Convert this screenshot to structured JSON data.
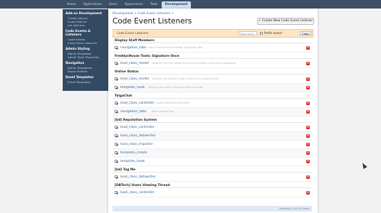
{
  "topnav": {
    "tabs": [
      {
        "label": "Home"
      },
      {
        "label": "Applications"
      },
      {
        "label": "Users"
      },
      {
        "label": "Appearance"
      },
      {
        "label": "Tools"
      },
      {
        "label": "Development"
      }
    ],
    "active_tab": "Development"
  },
  "sidebar": {
    "groups": [
      {
        "heading": "Add-on Development",
        "items": [
          "Create Add-on",
          "Install Add-on",
          "List Add-ons"
        ]
      },
      {
        "heading": "Code Events & Listeners",
        "items": [
          "Code Events",
          "Code Event Listeners"
        ]
      },
      {
        "heading": "Admin Styling",
        "items": [
          "Admin Templates",
          "Admin Style Properties"
        ]
      },
      {
        "heading": "Navigation",
        "items": [
          "Admin Navigation",
          "Route Prefixes"
        ]
      },
      {
        "heading": "Email Templates",
        "items": [
          "Email Templates"
        ]
      }
    ]
  },
  "breadcrumb": {
    "items": [
      "Development >",
      "Code Event Listeners >"
    ]
  },
  "page": {
    "title": "Code Event Listeners",
    "create_button": "+ Create New Code Event Listener"
  },
  "filter": {
    "title": "Code Event Listeners",
    "placeholder": "Filter items",
    "prefix_label": "Prefix match",
    "clear_label": "Clear"
  },
  "groups": [
    {
      "heading": "Display Staff Members",
      "rows": [
        {
          "name": "navigation_tabs",
          "desc": "Adds a Tab to Forum Header Navigation Bar"
        }
      ]
    },
    {
      "heading": "FreddysHouse Tools: Signature Once",
      "rows": [
        {
          "name": "load_class_model",
          "desc": "Modifies the Post model to remove multiple instances of signatures"
        }
      ]
    },
    {
      "heading": "Online Status",
      "rows": [
        {
          "name": "load_class_model",
          "desc": "Extends the model to add a field to the session table"
        },
        {
          "name": "template_hook",
          "desc": "Displays the online indicator within member"
        }
      ]
    },
    {
      "heading": "TaigaChat",
      "rows": [
        {
          "name": "load_class_controller",
          "desc": "Loads taigachat controllers"
        },
        {
          "name": "navigation_tabs",
          "desc": "Adds chatbox tab"
        }
      ]
    },
    {
      "heading": "[bd] Reputation System",
      "rows": [
        {
          "name": "load_class_controller",
          "desc": ""
        },
        {
          "name": "load_class_datawriter",
          "desc": ""
        },
        {
          "name": "load_class_importer",
          "desc": ""
        },
        {
          "name": "template_create",
          "desc": ""
        },
        {
          "name": "template_hook",
          "desc": ""
        }
      ]
    },
    {
      "heading": "[bd] Tag Me",
      "rows": [
        {
          "name": "load_class_datawriter",
          "desc": ""
        }
      ]
    },
    {
      "heading": "[DBTech] Users Viewing Thread",
      "rows": [
        {
          "name": "load_class_controller",
          "desc": ""
        }
      ]
    }
  ],
  "footer": {
    "text": "Showing 13 of 13 items"
  },
  "icons": {
    "delete": "delete-x-icon",
    "checkbox": "checkbox-checked-icon"
  },
  "colors": {
    "accent": "#3b4f66",
    "delete": "#d92b2b",
    "filterbar": "#fde5c6"
  }
}
